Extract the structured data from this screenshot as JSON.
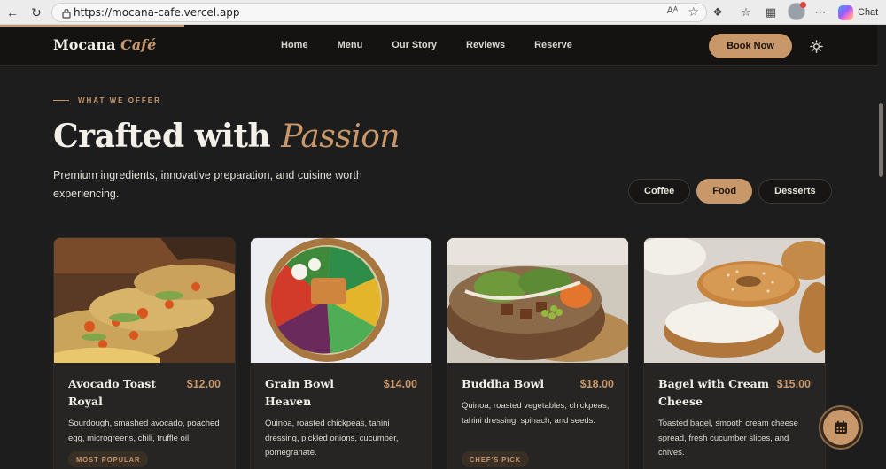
{
  "browser": {
    "url": "https://mocana-cafe.vercel.app",
    "read_aloud": "Aᴬ",
    "chat_label": "Chat"
  },
  "site": {
    "logo_main": "Mocana",
    "logo_accent": "Café",
    "nav": [
      "Home",
      "Menu",
      "Our Story",
      "Reviews",
      "Reserve"
    ],
    "cta": "Book Now",
    "accent_color": "#c8976a"
  },
  "section": {
    "eyebrow": "WHAT WE OFFER",
    "headline_main": "Crafted with",
    "headline_accent": "Passion",
    "subtitle": "Premium ingredients, innovative preparation, and cuisine worth experiencing."
  },
  "filters": [
    {
      "label": "Coffee",
      "active": false
    },
    {
      "label": "Food",
      "active": true
    },
    {
      "label": "Desserts",
      "active": false
    }
  ],
  "menu_items": [
    {
      "name": "Avocado Toast Royal",
      "price": "$12.00",
      "description": "Sourdough, smashed avocado, poached egg, microgreens, chili, truffle oil.",
      "badge": "MOST POPULAR"
    },
    {
      "name": "Grain Bowl Heaven",
      "price": "$14.00",
      "description": "Quinoa, roasted chickpeas, tahini dressing, pickled onions, cucumber, pomegranate.",
      "badge": ""
    },
    {
      "name": "Buddha Bowl",
      "price": "$18.00",
      "description": "Quinoa, roasted vegetables, chickpeas, tahini dressing, spinach, and seeds.",
      "badge": "CHEF'S PICK"
    },
    {
      "name": "Bagel with Cream Cheese",
      "price": "$15.00",
      "description": "Toasted bagel, smooth cream cheese spread, fresh cucumber slices, and chives.",
      "badge": ""
    }
  ]
}
